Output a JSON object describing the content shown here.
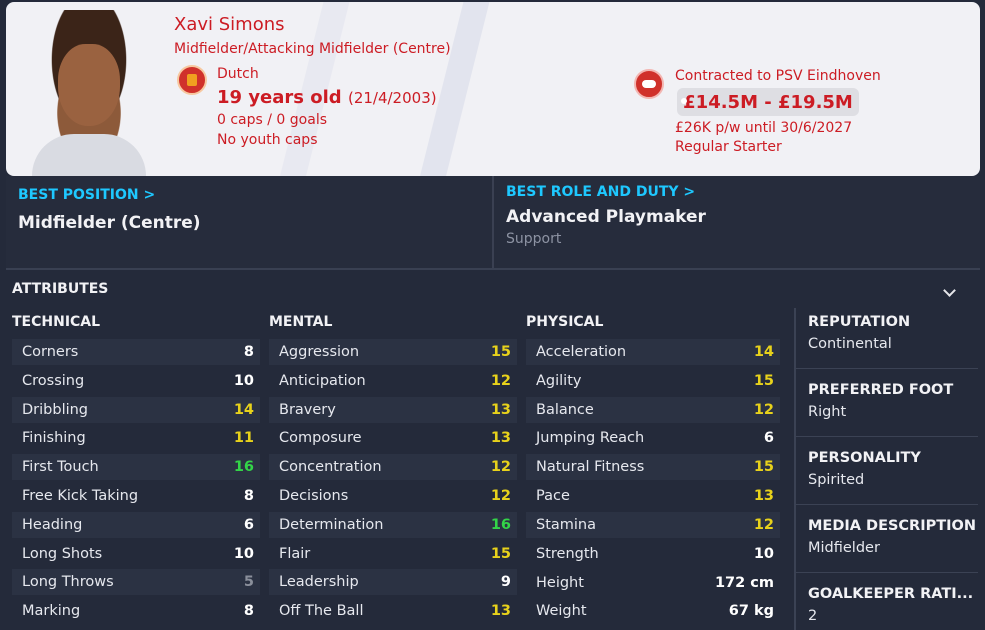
{
  "player": {
    "name": "Xavi Simons",
    "positions": "Midfielder/Attacking Midfielder (Centre)",
    "nationality": "Dutch",
    "age": "19 years old",
    "dob": "(21/4/2003)",
    "caps": "0 caps / 0 goals",
    "youth_caps": "No youth caps"
  },
  "contract": {
    "club_line": "Contracted to PSV Eindhoven",
    "value_range": "£14.5M - £19.5M",
    "wage_line": "£26K p/w until 30/6/2027",
    "status": "Regular Starter"
  },
  "best": {
    "position_title": "BEST POSITION >",
    "position_value": "Midfielder (Centre)",
    "role_title": "BEST ROLE AND DUTY >",
    "role_value": "Advanced Playmaker",
    "role_duty": "Support"
  },
  "attributes": {
    "heading": "ATTRIBUTES",
    "technical_title": "TECHNICAL",
    "mental_title": "MENTAL",
    "physical_title": "PHYSICAL",
    "technical": [
      {
        "label": "Corners",
        "value": "8",
        "tone": "white"
      },
      {
        "label": "Crossing",
        "value": "10",
        "tone": "white"
      },
      {
        "label": "Dribbling",
        "value": "14",
        "tone": "yellow"
      },
      {
        "label": "Finishing",
        "value": "11",
        "tone": "yellow"
      },
      {
        "label": "First Touch",
        "value": "16",
        "tone": "green"
      },
      {
        "label": "Free Kick Taking",
        "value": "8",
        "tone": "white"
      },
      {
        "label": "Heading",
        "value": "6",
        "tone": "white"
      },
      {
        "label": "Long Shots",
        "value": "10",
        "tone": "white"
      },
      {
        "label": "Long Throws",
        "value": "5",
        "tone": "grey"
      },
      {
        "label": "Marking",
        "value": "8",
        "tone": "white"
      }
    ],
    "mental": [
      {
        "label": "Aggression",
        "value": "15",
        "tone": "yellow"
      },
      {
        "label": "Anticipation",
        "value": "12",
        "tone": "yellow"
      },
      {
        "label": "Bravery",
        "value": "13",
        "tone": "yellow"
      },
      {
        "label": "Composure",
        "value": "13",
        "tone": "yellow"
      },
      {
        "label": "Concentration",
        "value": "12",
        "tone": "yellow"
      },
      {
        "label": "Decisions",
        "value": "12",
        "tone": "yellow"
      },
      {
        "label": "Determination",
        "value": "16",
        "tone": "green"
      },
      {
        "label": "Flair",
        "value": "15",
        "tone": "yellow"
      },
      {
        "label": "Leadership",
        "value": "9",
        "tone": "white"
      },
      {
        "label": "Off The Ball",
        "value": "13",
        "tone": "yellow"
      }
    ],
    "physical": [
      {
        "label": "Acceleration",
        "value": "14",
        "tone": "yellow"
      },
      {
        "label": "Agility",
        "value": "15",
        "tone": "yellow"
      },
      {
        "label": "Balance",
        "value": "12",
        "tone": "yellow"
      },
      {
        "label": "Jumping Reach",
        "value": "6",
        "tone": "white"
      },
      {
        "label": "Natural Fitness",
        "value": "15",
        "tone": "yellow"
      },
      {
        "label": "Pace",
        "value": "13",
        "tone": "yellow"
      },
      {
        "label": "Stamina",
        "value": "12",
        "tone": "yellow"
      },
      {
        "label": "Strength",
        "value": "10",
        "tone": "white"
      }
    ],
    "height": {
      "label": "Height",
      "value": "172 cm"
    },
    "weight": {
      "label": "Weight",
      "value": "67 kg"
    }
  },
  "side": {
    "reputation_label": "REPUTATION",
    "reputation_value": "Continental",
    "foot_label": "PREFERRED FOOT",
    "foot_value": "Right",
    "personality_label": "PERSONALITY",
    "personality_value": "Spirited",
    "media_label": "MEDIA DESCRIPTION",
    "media_value": "Midfielder",
    "gk_label": "GOALKEEPER RATI...",
    "gk_value": "2"
  },
  "colors": {
    "accent_red": "#cc1c24",
    "accent_blue": "#1ec8ff",
    "attr_yellow": "#e8d21b",
    "attr_green": "#33d448"
  }
}
